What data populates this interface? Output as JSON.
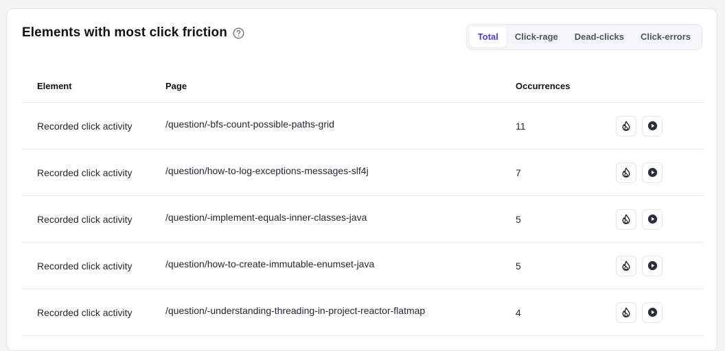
{
  "card": {
    "title": "Elements with most click friction"
  },
  "tabs": [
    {
      "label": "Total",
      "active": true
    },
    {
      "label": "Click-rage",
      "active": false
    },
    {
      "label": "Dead-clicks",
      "active": false
    },
    {
      "label": "Click-errors",
      "active": false
    }
  ],
  "table": {
    "headers": {
      "element": "Element",
      "page": "Page",
      "occurrences": "Occurrences"
    },
    "rows": [
      {
        "element": "Recorded click activity",
        "page": "/question/-bfs-count-possible-paths-grid",
        "occurrences": "11"
      },
      {
        "element": "Recorded click activity",
        "page": "/question/how-to-log-exceptions-messages-slf4j",
        "occurrences": "7"
      },
      {
        "element": "Recorded click activity",
        "page": "/question/-implement-equals-inner-classes-java",
        "occurrences": "5"
      },
      {
        "element": "Recorded click activity",
        "page": "/question/how-to-create-immutable-enumset-java",
        "occurrences": "5"
      },
      {
        "element": "Recorded click activity",
        "page": "/question/-understanding-threading-in-project-reactor-flatmap",
        "occurrences": "4"
      }
    ]
  },
  "icons": {
    "help": "help-circle-icon",
    "heatmap": "flame-icon",
    "replay": "play-circle-icon"
  },
  "colors": {
    "accent": "#4a3fe0",
    "text": "#0f1117",
    "border": "#e5e7eb"
  }
}
